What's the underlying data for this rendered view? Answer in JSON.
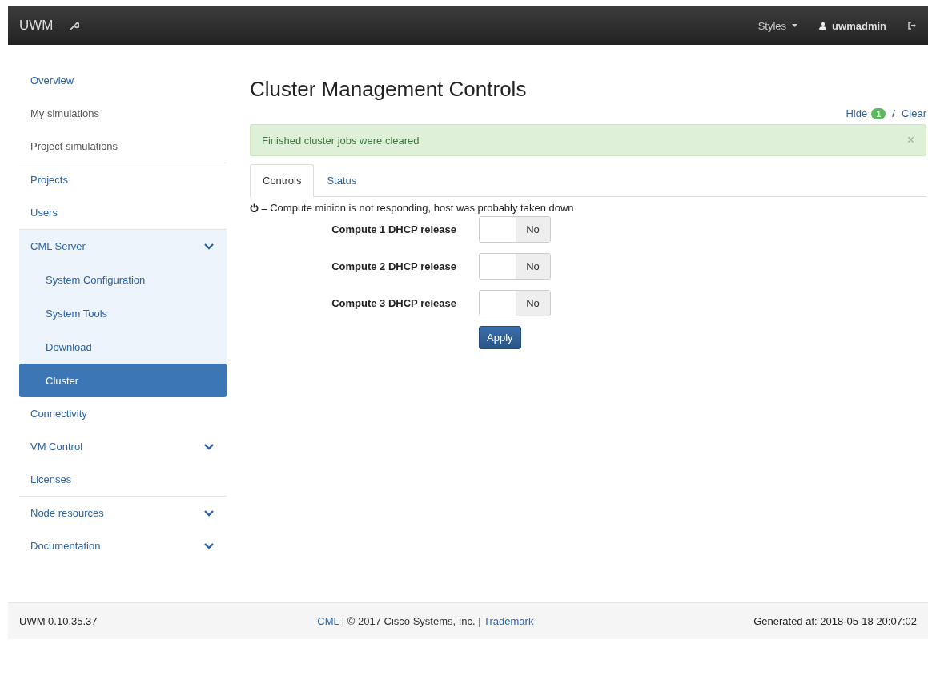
{
  "navbar": {
    "brand": "UWM",
    "styles_menu": "Styles",
    "user": "uwmadmin"
  },
  "sidebar": {
    "items": [
      {
        "label": "Overview",
        "kind": "link",
        "selected": false,
        "divider_after": false
      },
      {
        "label": "My simulations",
        "kind": "plain",
        "selected": false,
        "divider_after": false
      },
      {
        "label": "Project simulations",
        "kind": "plain",
        "selected": false,
        "divider_after": true
      },
      {
        "label": "Projects",
        "kind": "link",
        "selected": false,
        "divider_after": false
      },
      {
        "label": "Users",
        "kind": "link",
        "selected": false,
        "divider_after": true
      },
      {
        "label": "CML Server",
        "kind": "group",
        "selected": false,
        "expanded": true,
        "divider_after": false,
        "children": [
          {
            "label": "System Configuration",
            "selected": false
          },
          {
            "label": "System Tools",
            "selected": false
          },
          {
            "label": "Download",
            "selected": false
          },
          {
            "label": "Cluster",
            "selected": true
          }
        ]
      },
      {
        "label": "Connectivity",
        "kind": "link",
        "selected": false,
        "divider_after": false
      },
      {
        "label": "VM Control",
        "kind": "group",
        "selected": false,
        "expanded": false,
        "divider_after": false
      },
      {
        "label": "Licenses",
        "kind": "link",
        "selected": false,
        "divider_after": true
      },
      {
        "label": "Node resources",
        "kind": "group",
        "selected": false,
        "expanded": false,
        "divider_after": false
      },
      {
        "label": "Documentation",
        "kind": "group",
        "selected": false,
        "expanded": false,
        "divider_after": false
      }
    ]
  },
  "main": {
    "title": "Cluster Management Controls",
    "notice_links": {
      "hide": "Hide",
      "count": "1",
      "separator": "/",
      "clear": "Clear"
    },
    "alert": {
      "message": "Finished cluster jobs were cleared",
      "close": "×"
    },
    "tabs": [
      {
        "label": "Controls",
        "selected": true
      },
      {
        "label": "Status",
        "selected": false
      }
    ],
    "legend": "= Compute minion is not responding, host was probably taken down",
    "controls": [
      {
        "label": "Compute 1 DHCP release",
        "on": false,
        "state_label": "No"
      },
      {
        "label": "Compute 2 DHCP release",
        "on": false,
        "state_label": "No"
      },
      {
        "label": "Compute 3 DHCP release",
        "on": false,
        "state_label": "No"
      }
    ],
    "apply_button": "Apply"
  },
  "footer": {
    "version": "UWM 0.10.35.37",
    "credits": {
      "link_1": "CML",
      "text": " | © 2017 Cisco Systems, Inc. | ",
      "link_2": "Trademark"
    },
    "generated": "Generated at: 2018-05-18 20:07:02"
  }
}
